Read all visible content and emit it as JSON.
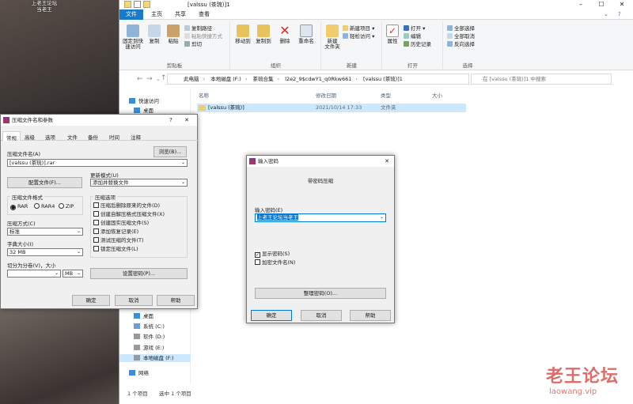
{
  "desktop": {
    "icon_label_1": "上老王论坛",
    "icon_label_2": "当老王"
  },
  "explorer": {
    "title": "[valssu (茶琉)]1",
    "tabs": [
      "文件",
      "主页",
      "共享",
      "查看"
    ],
    "ribbon": {
      "pin": "固定到快速访问",
      "copy": "复制",
      "paste": "粘贴",
      "copy_path": "复制路径",
      "paste_shortcut": "粘贴快捷方式",
      "cut": "剪切",
      "clipboard": "剪贴板",
      "move_to": "移动到",
      "copy_to": "复制到",
      "delete": "删除",
      "rename": "重命名",
      "organize": "组织",
      "new_folder": "新建\n文件夹",
      "new_item": "新建项目 ▾",
      "easy_access": "轻松访问 ▾",
      "new": "新建",
      "properties": "属性",
      "open": "打开 ▾",
      "edit": "编辑",
      "history": "历史记录",
      "open_group": "打开",
      "select_all": "全部选择",
      "select_none": "全部取消",
      "invert": "反向选择",
      "select_group": "选择"
    },
    "address": [
      "此电脑",
      "本地磁盘 (F:)",
      "茶琉合集",
      "l2e2_9$cdwY1_q0Rkw661",
      "[valssu (茶琉)]1"
    ],
    "search_placeholder": "在 [valssu (茶琉)]1 中搜索",
    "nav": {
      "quick_access": "快速访问",
      "desktop1": "桌面",
      "desktop2": "桌面",
      "system": "系统 (C:)",
      "software": "软件 (D:)",
      "games": "游戏 (E:)",
      "local": "本地磁盘 (F:)",
      "network": "网络"
    },
    "columns": {
      "name": "名称",
      "date": "修改日期",
      "type": "类型",
      "size": "大小"
    },
    "row": {
      "name": "[valssu (茶琉)]",
      "date": "2021/10/14 17:33",
      "type": "文件夹"
    },
    "status": {
      "count": "1 个项目",
      "selected": "选中 1 个项目"
    }
  },
  "rar_dialog": {
    "title": "压缩文件名和参数",
    "tabs": [
      "常规",
      "高级",
      "选项",
      "文件",
      "备份",
      "时间",
      "注释"
    ],
    "archive_name_label": "压缩文件名(A)",
    "browse": "浏览(B)...",
    "archive_name": "[valssu (茶琉)].rar",
    "profiles": "配置文件(F)...",
    "update_mode_label": "更新模式(U)",
    "update_mode": "添加并替换文件",
    "format_label": "压缩文件格式",
    "formats": [
      "RAR",
      "RAR4",
      "ZIP"
    ],
    "method_label": "压缩方式(C)",
    "method": "标准",
    "dict_label": "字典大小(I)",
    "dict": "32 MB",
    "split_label": "切分为分卷(V)，大小",
    "split_unit": "MB",
    "options_label": "压缩选项",
    "options": [
      "压缩后删除原来的文件(D)",
      "创建自解压格式压缩文件(X)",
      "创建固实压缩文件(S)",
      "添加恢复记录(E)",
      "测试压缩的文件(T)",
      "锁定压缩文件(L)"
    ],
    "set_password": "设置密码(P)...",
    "ok": "确定",
    "cancel": "取消",
    "help": "帮助"
  },
  "pw_dialog": {
    "title": "输入密码",
    "heading": "带密码压缩",
    "label": "输入密码(E)",
    "value": "上老王论坛当老王",
    "show_pw": "显示密码(S)",
    "encrypt_names": "加密文件名(N)",
    "manage": "整理密码(O)...",
    "ok": "确定",
    "cancel": "取消",
    "help": "帮助"
  },
  "watermark": {
    "title": "老王论坛",
    "url": "laowang.vip"
  }
}
